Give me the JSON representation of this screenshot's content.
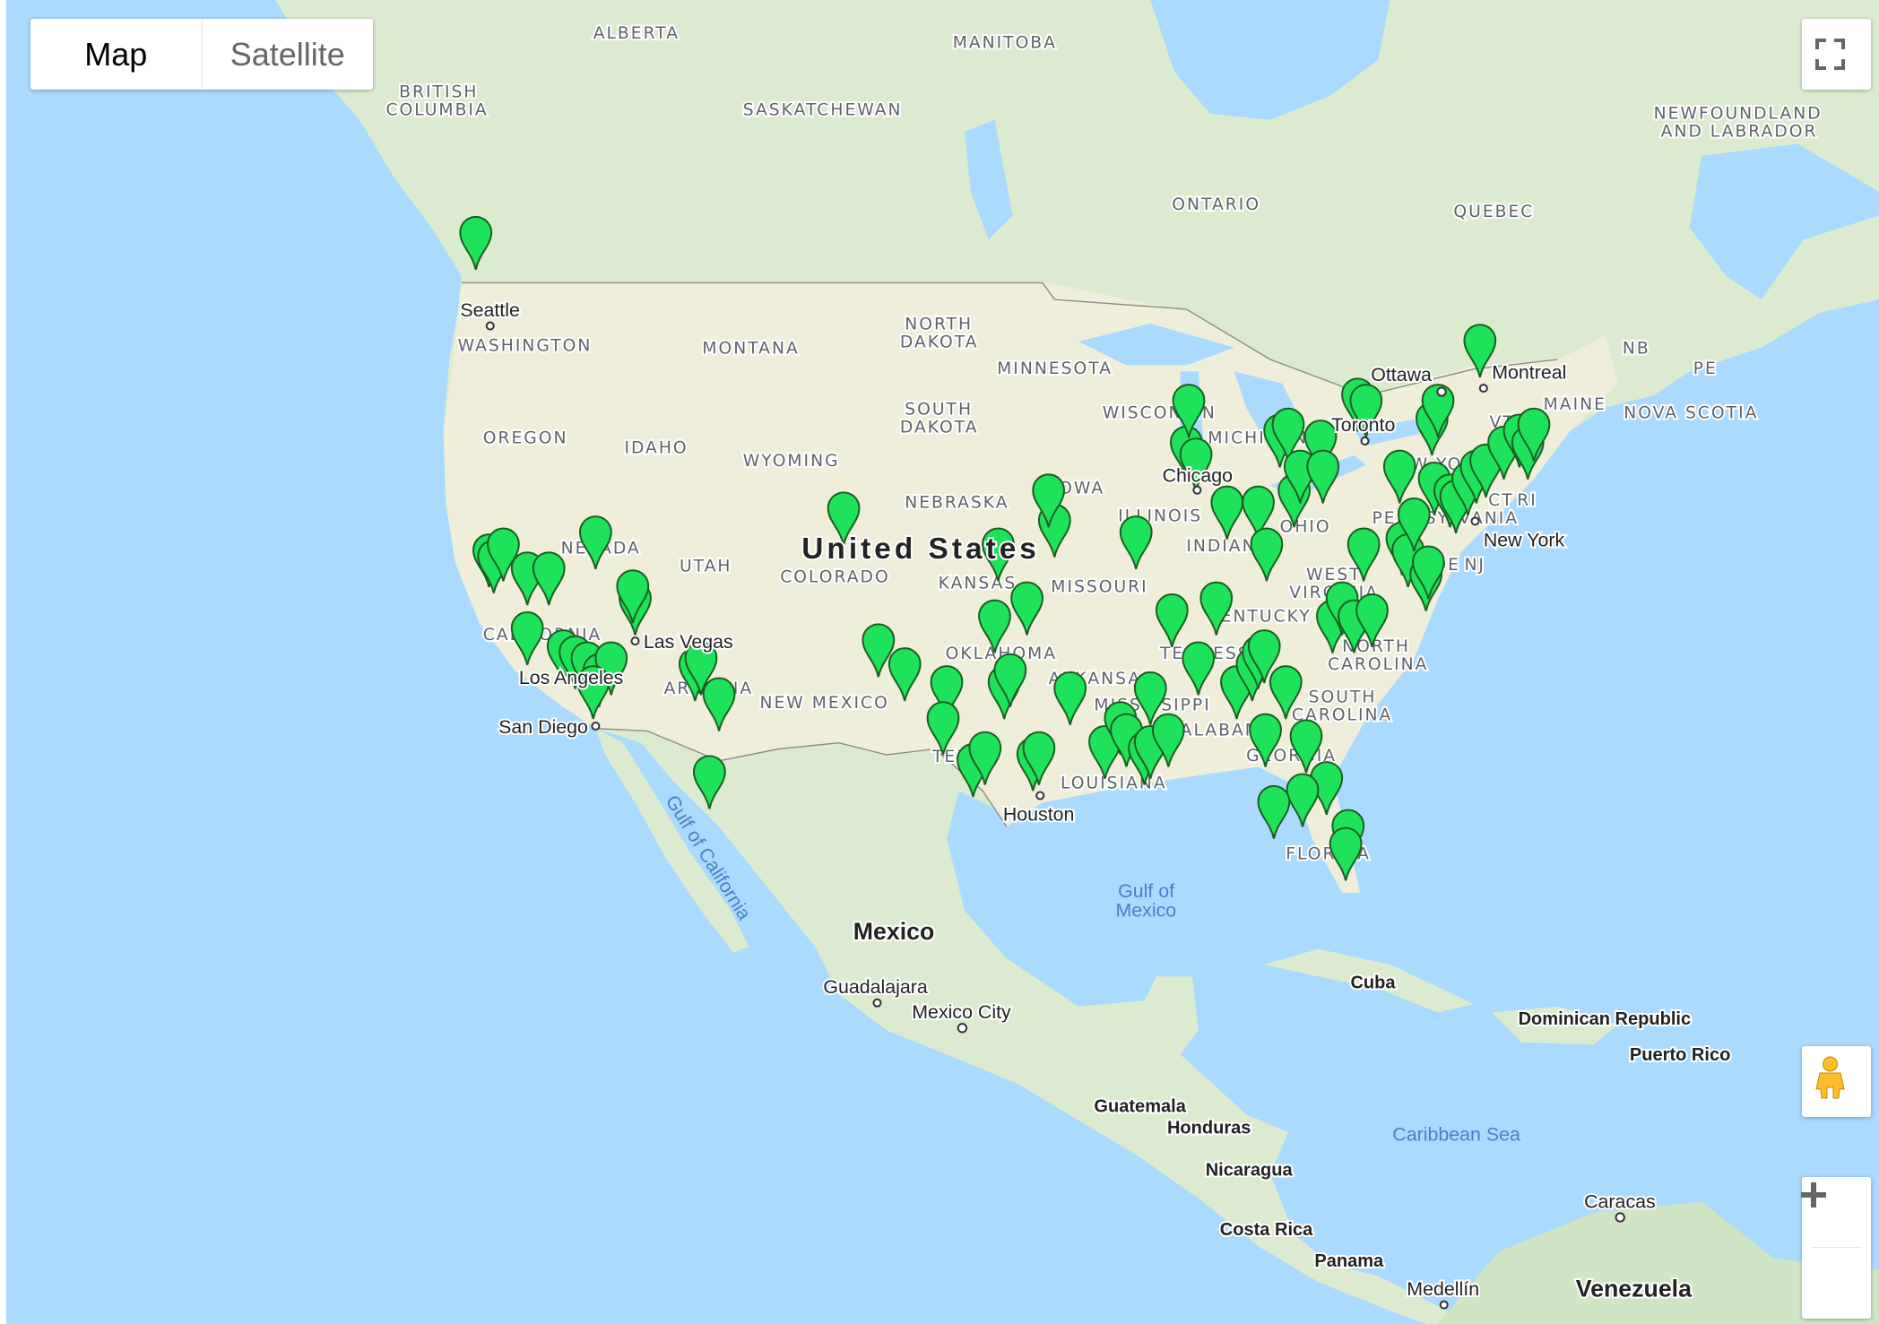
{
  "map_type": {
    "map_label": "Map",
    "satellite_label": "Satellite",
    "selected": "Map"
  },
  "controls": {
    "fullscreen_icon": "fullscreen-icon",
    "pegman_icon": "street-view-pegman-icon",
    "zoom_in_icon": "plus-icon",
    "zoom_out_icon": "minus-icon"
  },
  "colors": {
    "water": "#aadaff",
    "land": "#dcebcf",
    "us_land": "#f1eedd",
    "marker": "#1ee35a",
    "marker_outline": "#1b5e20"
  },
  "map": {
    "countries": [
      "United States",
      "Mexico",
      "Cuba",
      "Dominican Republic",
      "Guatemala",
      "Honduras",
      "Nicaragua",
      "Costa Rica",
      "Panama",
      "Venezuela",
      "Puerto Rico"
    ],
    "regions": [
      "ALBERTA",
      "MANITOBA",
      "BRITISH",
      "COLUMBIA",
      "SASKATCHEWAN",
      "NEWFOUNDLAND",
      "AND LABRADOR",
      "ONTARIO",
      "QUEBEC",
      "WASHINGTON",
      "MONTANA",
      "NORTH",
      "DAKOTA",
      "MINNESOTA",
      "SOUTH",
      "DAKOTA",
      "OREGON",
      "IDAHO",
      "WYOMING",
      "WISCONSIN",
      "MICHIGAN",
      "IOWA",
      "NEBRASKA",
      "NEVADA",
      "UTAH",
      "COLORADO",
      "KANSAS",
      "MISSOURI",
      "ILLINOIS",
      "INDIANA",
      "OHIO",
      "CALIFORNIA",
      "ARIZONA",
      "NEW MEXICO",
      "OKLAHOMA",
      "ARKANSAS",
      "TENNESSEE",
      "KENTUCKY",
      "MISSISSIPPI",
      "ALABAMA",
      "GEORGIA",
      "LOUISIANA",
      "TEXAS",
      "FLORIDA",
      "SOUTH",
      "CAROLINA",
      "NORTH",
      "CAROLINA",
      "WEST",
      "VIRGINIA",
      "NEW YORK",
      "PENNSYLVANIA",
      "NJ",
      "DE",
      "VT",
      "MAINE",
      "NB",
      "PE",
      "NOVA SCOTIA",
      "CT",
      "RI"
    ],
    "cities": [
      "Seattle",
      "Ottawa",
      "Montreal",
      "Toronto",
      "Chicago",
      "New York",
      "Las Vegas",
      "Los Angeles",
      "San Diego",
      "Houston",
      "Guadalajara",
      "Mexico City",
      "Caracas",
      "Medellín"
    ],
    "water": [
      "Gulf of",
      "Mexico",
      "Gulf of California",
      "Caribbean Sea"
    ]
  }
}
